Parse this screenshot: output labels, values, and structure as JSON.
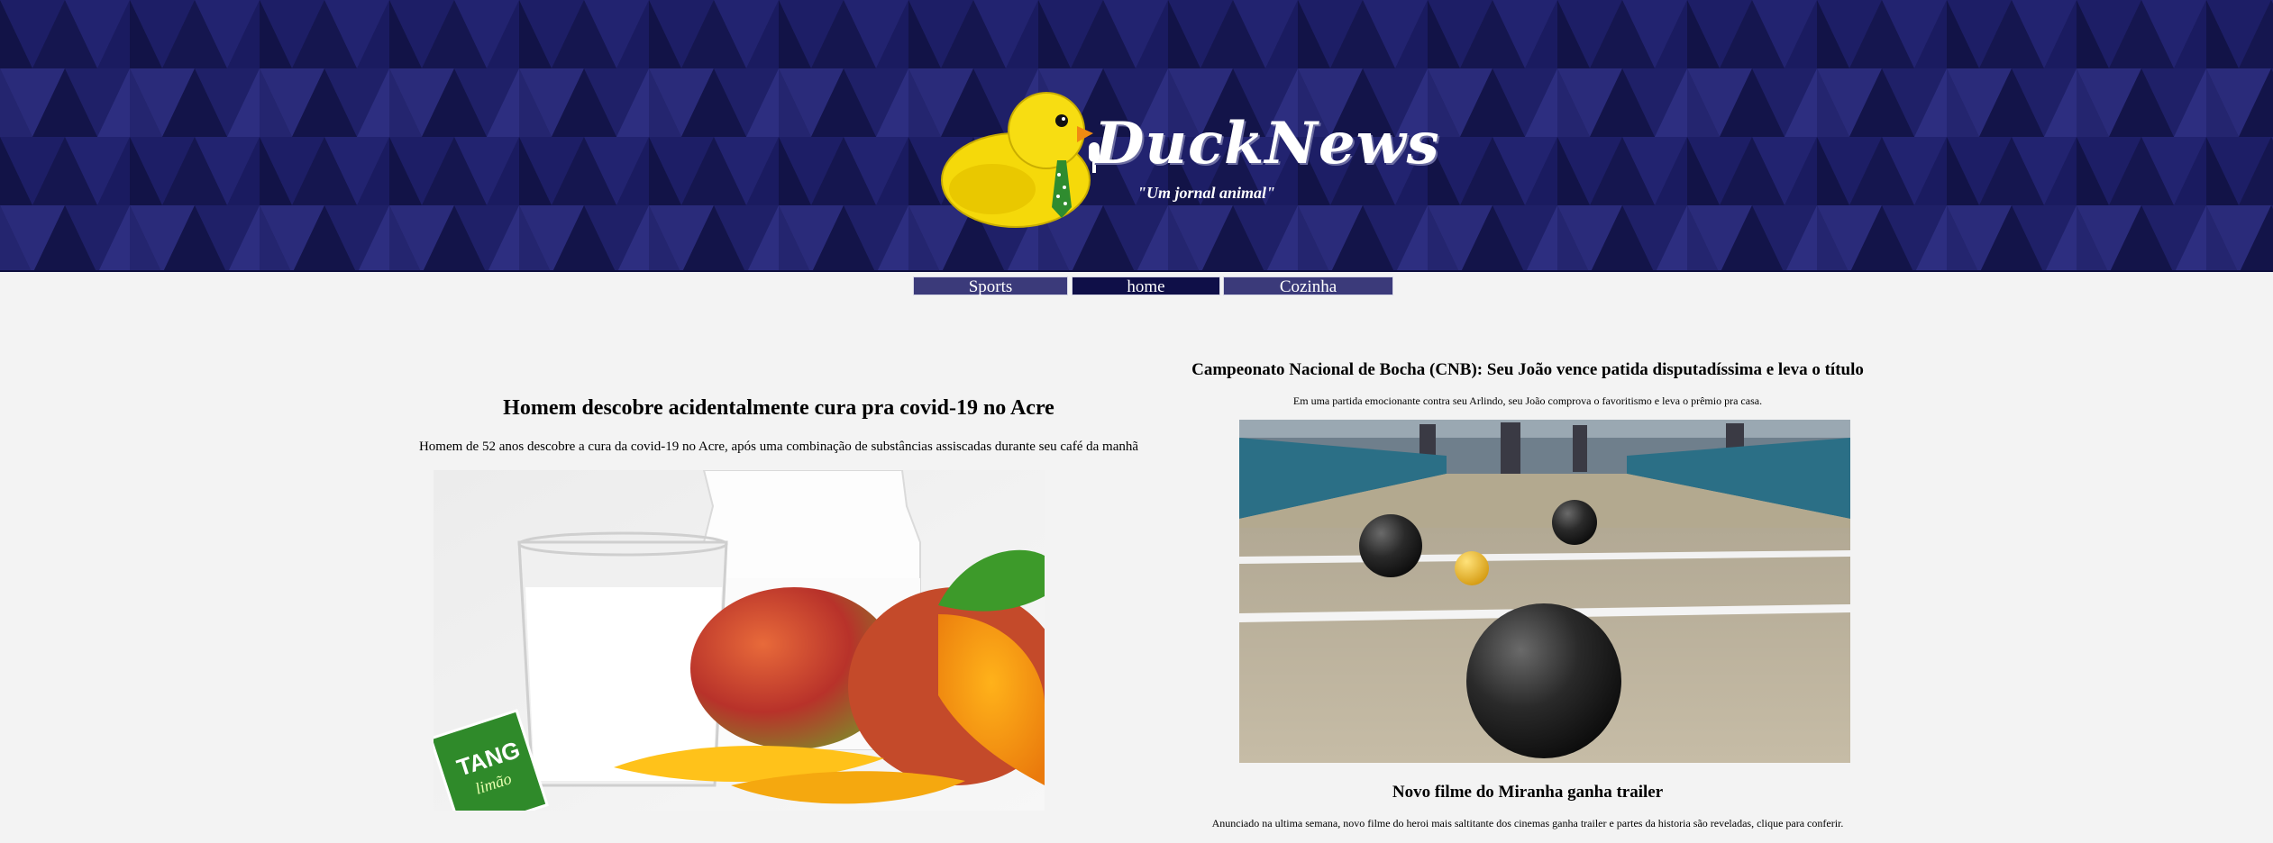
{
  "site": {
    "name": "DuckNews",
    "tagline": "\"Um jornal animal\""
  },
  "nav": {
    "items": [
      {
        "label": "Sports"
      },
      {
        "label": "home"
      },
      {
        "label": "Cozinha"
      }
    ]
  },
  "articles": [
    {
      "title": "Homem descobre acidentalmente cura pra covid-19 no Acre",
      "summary": "Homem de 52 anos descobre a cura da covid-19 no Acre, após uma combinação de substâncias assiscadas durante seu café da manhã",
      "image": {
        "packet_text": "TANG",
        "packet_sub": "limão"
      }
    },
    {
      "title": "Campeonato Nacional de Bocha (CNB): Seu João vence patida disputadíssima e leva o título",
      "summary": "Em uma partida emocionante contra seu Arlindo, seu João comprova o favoritismo e leva o prêmio pra casa."
    },
    {
      "title": "Novo filme do Miranha ganha trailer",
      "summary": "Anunciado na ultima semana, novo filme do heroi mais saltitante dos cinemas ganha trailer e partes da historia são reveladas, clique para conferir."
    }
  ],
  "colors": {
    "header_bg": "#15164f",
    "nav_active": "#0f0f48",
    "nav_inactive": "#3b3a7a",
    "page_bg": "#f3f3f3"
  }
}
